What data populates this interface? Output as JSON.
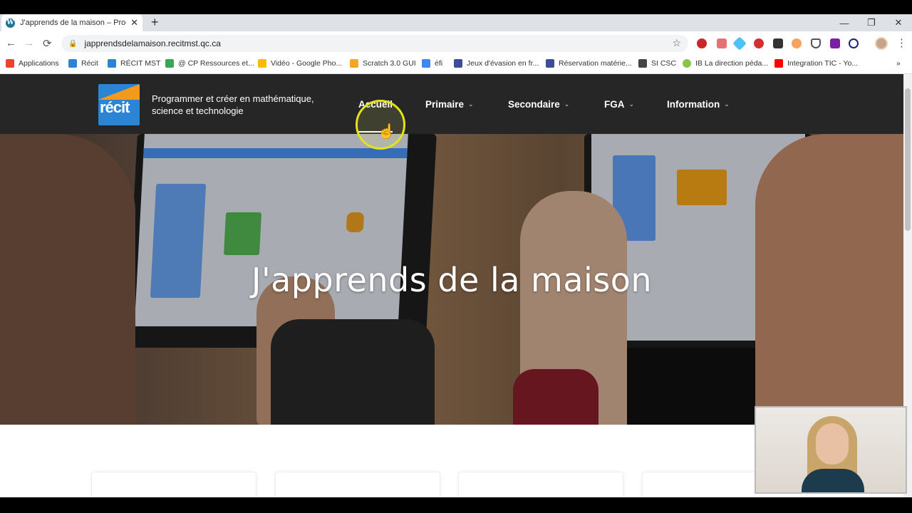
{
  "browser": {
    "tab": {
      "title": "J'apprends de la maison – Progra",
      "favicon": "W",
      "close": "✕"
    },
    "new_tab": "+",
    "window_controls": [
      "—",
      "❐",
      "✕"
    ],
    "url": "japprendsdelamaison.recitmst.qc.ca",
    "nav": {
      "back": "←",
      "forward": "→",
      "reload": "⟳"
    },
    "bookmarks": [
      {
        "label": "Applications",
        "icon": "apps-grid-icon",
        "color": "#ea4335"
      },
      {
        "label": "Récit",
        "icon": "recit-icon",
        "color": "#2c84d4"
      },
      {
        "label": "RÉCIT MST",
        "icon": "recit-icon",
        "color": "#2c84d4"
      },
      {
        "label": "@ CP Ressources et...",
        "icon": "drive-icon",
        "color": "#34a853"
      },
      {
        "label": "Vidéo - Google Pho...",
        "icon": "photos-icon",
        "color": "#fbbc05"
      },
      {
        "label": "Scratch 3.0 GUI",
        "icon": "scratch-icon",
        "color": "#f5a623"
      },
      {
        "label": "éfi",
        "icon": "docs-icon",
        "color": "#4285f4"
      },
      {
        "label": "Jeux d'évasion en fr...",
        "icon": "forms-icon",
        "color": "#3b4e9c"
      },
      {
        "label": "Réservation matérie...",
        "icon": "forms-icon",
        "color": "#3b4e9c"
      },
      {
        "label": "SI CSC",
        "icon": "csc-icon",
        "color": "#444444"
      },
      {
        "label": "IB La direction péda...",
        "icon": "ib-icon",
        "color": "#8bc34a"
      },
      {
        "label": "Integration TIC - Yo...",
        "icon": "youtube-icon",
        "color": "#ff0000"
      }
    ],
    "more_bookmarks": "»"
  },
  "site": {
    "logo_text": "récit",
    "tagline": "Programmer et créer en mathématique, science et technologie",
    "menu": [
      {
        "label": "Accueil",
        "dropdown": false
      },
      {
        "label": "Primaire",
        "dropdown": true
      },
      {
        "label": "Secondaire",
        "dropdown": true
      },
      {
        "label": "FGA",
        "dropdown": true
      },
      {
        "label": "Information",
        "dropdown": true
      }
    ],
    "hero_title": "J'apprends de la maison"
  },
  "colors": {
    "nav_bg": "#262626",
    "logo_blue": "#2c84d4",
    "logo_orange": "#f39a1d",
    "cursor_highlight": "#e6e21a"
  }
}
